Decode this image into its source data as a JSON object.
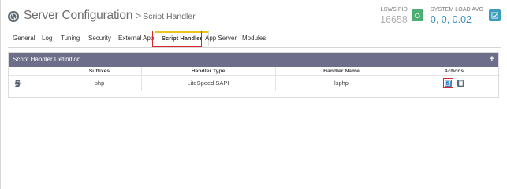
{
  "header": {
    "title": "Server Configuration",
    "separator": ">",
    "subtitle": "Script Handler",
    "icon": "globe-icon"
  },
  "status": {
    "pid_label": "LSWS PID",
    "pid_value": "16658",
    "load_label": "SYSTEM LOAD AVG",
    "load_value": "0, 0, 0.02",
    "restart_icon": "restart-icon",
    "chart_icon": "chart-icon",
    "colors": {
      "load_value": "#3a8dbd",
      "restart": "#4caf74",
      "chart": "#3b9dbd"
    }
  },
  "tabs": [
    {
      "label": "General",
      "active": false
    },
    {
      "label": "Log",
      "active": false
    },
    {
      "label": "Tuning",
      "active": false
    },
    {
      "label": "Security",
      "active": false
    },
    {
      "label": "External App",
      "active": false
    },
    {
      "label": "Script Handler",
      "active": true
    },
    {
      "label": "App Server",
      "active": false
    },
    {
      "label": "Modules",
      "active": false
    }
  ],
  "panel": {
    "title": "Script Handler Definition",
    "add_icon": "+",
    "columns": [
      "",
      "Suffixes",
      "Handler Type",
      "Handler Name",
      "Actions"
    ],
    "rows": [
      {
        "icon": "script-icon",
        "suffixes": "php",
        "handler_type": "LiteSpeed SAPI",
        "handler_name": "lsphp"
      }
    ]
  },
  "colors": {
    "header_bg": "#6d6e89",
    "active_tab_accent": "#ecc41b",
    "highlight": "#d9262a",
    "edit": "#3b82c4",
    "delete": "#5a6b7b"
  }
}
